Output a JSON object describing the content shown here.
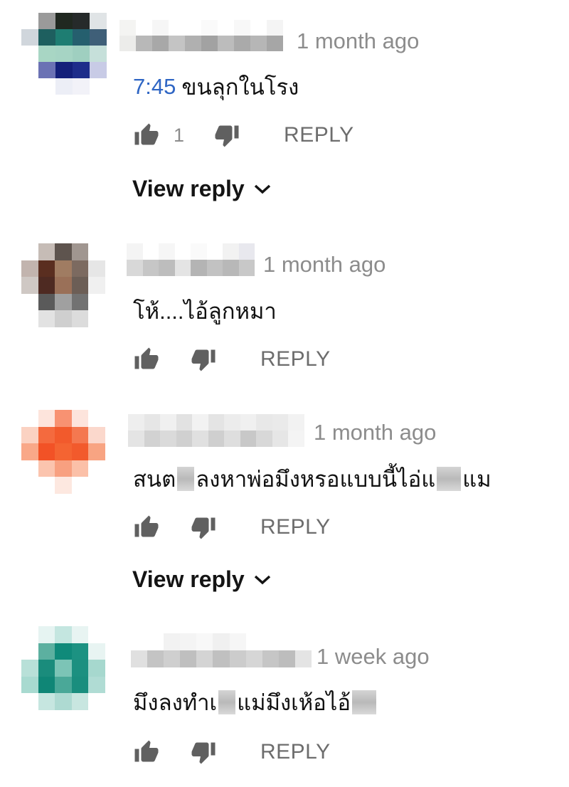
{
  "comments": [
    {
      "time": "1 month ago",
      "timestamp_link": "7:45",
      "text": "ขนลุกในโรง",
      "like_count": "1",
      "reply_label": "REPLY",
      "view_reply_label": "View reply"
    },
    {
      "time": "1 month ago",
      "text": "โห้....ไอ้ลูกหมา",
      "reply_label": "REPLY"
    },
    {
      "time": "1 month ago",
      "text_parts": [
        "สนต",
        "ลงหาพ่อมึงหรอแบบนี้ไอ่แ",
        "แม"
      ],
      "reply_label": "REPLY",
      "view_reply_label": "View reply"
    },
    {
      "time": "1 week ago",
      "text_parts": [
        "มึงลงทำเ",
        "แม่มึงเห้อไอ้"
      ],
      "reply_label": "REPLY"
    }
  ],
  "icons": {
    "like": "thumbs-up-icon",
    "dislike": "thumbs-down-icon",
    "expand": "chevron-down-icon"
  },
  "colors": {
    "timestamp_link": "#2f66c4",
    "meta_text": "#8c8c8c",
    "icon": "#606060"
  }
}
